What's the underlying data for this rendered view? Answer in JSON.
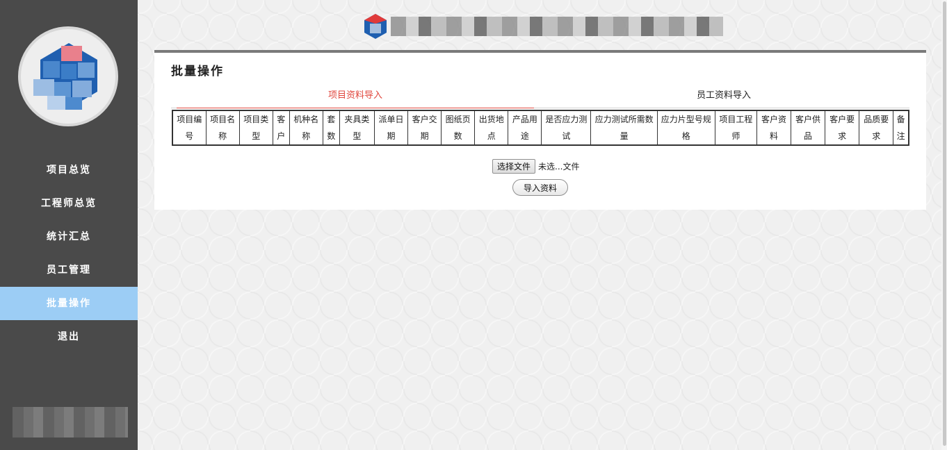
{
  "sidebar": {
    "nav": [
      {
        "label": "项目总览",
        "active": false
      },
      {
        "label": "工程师总览",
        "active": false
      },
      {
        "label": "统计汇总",
        "active": false
      },
      {
        "label": "员工管理",
        "active": false
      },
      {
        "label": "批量操作",
        "active": true
      },
      {
        "label": "退出",
        "active": false
      }
    ]
  },
  "panel": {
    "title": "批量操作",
    "tabs": [
      {
        "label": "项目资料导入",
        "active": true
      },
      {
        "label": "员工资料导入",
        "active": false
      }
    ],
    "columns": [
      "项目编号",
      "项目名称",
      "项目类型",
      "客户",
      "机种名称",
      "套数",
      "夹具类型",
      "派单日期",
      "客户交期",
      "图纸页数",
      "出货地点",
      "产品用途",
      "是否应力测试",
      "应力测试所需数量",
      "应力片型号规格",
      "项目工程师",
      "客户资料",
      "客户供品",
      "客户要求",
      "品质要求",
      "备注"
    ],
    "file_button": "选择文件",
    "file_status": "未选...文件",
    "import_button": "导入资料"
  },
  "colors": {
    "sidebar_bg": "#4a4a4a",
    "active_nav": "#9ccdf5",
    "active_tab": "#e0463c"
  }
}
